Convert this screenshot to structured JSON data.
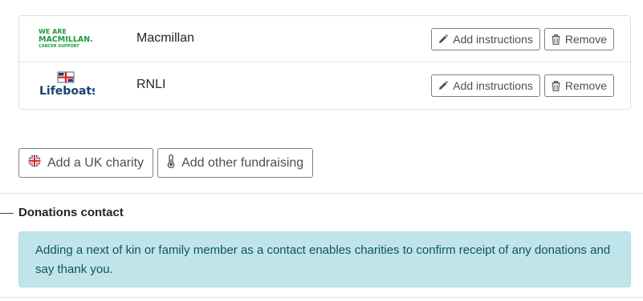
{
  "charities": [
    {
      "name": "Macmillan",
      "logo_lines": [
        "WE ARE",
        "MACMILLAN.",
        "CANCER SUPPORT"
      ],
      "add_instructions_label": "Add instructions",
      "remove_label": "Remove"
    },
    {
      "name": "RNLI",
      "logo_lines": [
        "Lifeboats"
      ],
      "add_instructions_label": "Add instructions",
      "remove_label": "Remove"
    }
  ],
  "add_buttons": {
    "uk_charity_label": "Add a UK charity",
    "other_fundraising_label": "Add other fundraising"
  },
  "donations_contact": {
    "title": "Donations contact",
    "info": "Adding a next of kin or family member as a contact enables charities to confirm receipt of any donations and say thank you."
  },
  "colors": {
    "macmillan_green": "#1b9e3e",
    "rnli_blue": "#16436e",
    "rnli_red": "#e1261c",
    "info_bg": "#bfe5ea",
    "info_text": "#0e5461",
    "button_border": "#7a8086"
  },
  "icons": {
    "add_instructions": "pencil-icon",
    "remove": "trash-icon",
    "uk_charity": "union-jack-icon",
    "other_fundraising": "thermometer-icon"
  }
}
